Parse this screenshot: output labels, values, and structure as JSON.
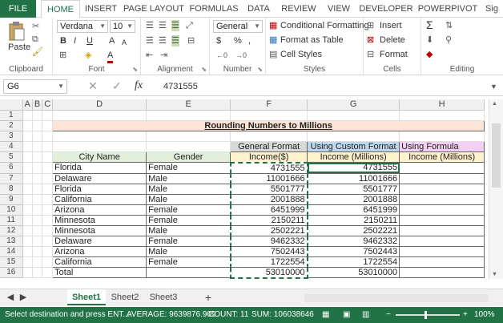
{
  "ribbon_tabs": [
    "FILE",
    "HOME",
    "INSERT",
    "PAGE LAYOUT",
    "FORMULAS",
    "DATA",
    "REVIEW",
    "VIEW",
    "DEVELOPER",
    "POWERPIVOT",
    "Sig"
  ],
  "clipboard": {
    "paste": "Paste",
    "label": "Clipboard"
  },
  "font": {
    "name": "Verdana",
    "size": "10",
    "bold": "B",
    "italic": "I",
    "underline": "U",
    "grow": "A",
    "shrink": "A",
    "font_color": "A",
    "label": "Font"
  },
  "alignment": {
    "label": "Alignment"
  },
  "number": {
    "format": "General",
    "currency": "$",
    "percent": "%",
    "comma": ",",
    "label": "Number"
  },
  "styles": {
    "conditional": "Conditional Formatting",
    "format_table": "Format as Table",
    "cell_styles": "Cell Styles",
    "label": "Styles"
  },
  "cells": {
    "insert": "Insert",
    "delete": "Delete",
    "format": "Format",
    "label": "Cells"
  },
  "editing": {
    "sum": "Σ",
    "label": "Editing"
  },
  "formula_bar": {
    "name_box": "G6",
    "fx": "fx",
    "value": "4731555"
  },
  "columns": [
    "A",
    "B",
    "C",
    "D",
    "E",
    "F",
    "G",
    "H"
  ],
  "rows": [
    {
      "n": "1",
      "D": "",
      "E": "",
      "F": "",
      "G": "",
      "H": ""
    },
    {
      "n": "2",
      "D": "",
      "E": "",
      "F": "",
      "G": "",
      "H": ""
    },
    {
      "n": "3",
      "D": "",
      "E": "",
      "F": "",
      "G": "",
      "H": ""
    },
    {
      "n": "4",
      "D": "",
      "E": "",
      "F": "",
      "G": "",
      "H": ""
    },
    {
      "n": "5",
      "D": "",
      "E": "",
      "F": "",
      "G": "",
      "H": ""
    },
    {
      "n": "6",
      "D": "Florida",
      "E": "Female",
      "F": "4731555",
      "G": "4731555",
      "H": ""
    },
    {
      "n": "7",
      "D": "Delaware",
      "E": "Male",
      "F": "11001666",
      "G": "11001666",
      "H": ""
    },
    {
      "n": "8",
      "D": "Florida",
      "E": "Male",
      "F": "5501777",
      "G": "5501777",
      "H": ""
    },
    {
      "n": "9",
      "D": "California",
      "E": "Male",
      "F": "2001888",
      "G": "2001888",
      "H": ""
    },
    {
      "n": "10",
      "D": "Arizona",
      "E": "Female",
      "F": "6451999",
      "G": "6451999",
      "H": ""
    },
    {
      "n": "11",
      "D": "Minnesota",
      "E": "Female",
      "F": "2150211",
      "G": "2150211",
      "H": ""
    },
    {
      "n": "12",
      "D": "Minnesota",
      "E": "Male",
      "F": "2502221",
      "G": "2502221",
      "H": ""
    },
    {
      "n": "13",
      "D": "Delaware",
      "E": "Female",
      "F": "9462332",
      "G": "9462332",
      "H": ""
    },
    {
      "n": "14",
      "D": "Arizona",
      "E": "Male",
      "F": "7502443",
      "G": "7502443",
      "H": ""
    },
    {
      "n": "15",
      "D": "California",
      "E": "Female",
      "F": "1722554",
      "G": "1722554",
      "H": ""
    },
    {
      "n": "16",
      "D": "Total",
      "E": "",
      "F": "53010000",
      "G": "53010000",
      "H": ""
    }
  ],
  "title": "Rounding Numbers to Millions",
  "headers4": {
    "F": "General Format",
    "G": "Using Custom Format",
    "H": "Using Formula"
  },
  "headers5": {
    "D": "City Name",
    "E": "Gender",
    "F": "Income($)",
    "G": "Income (Millions)",
    "H": "Income (Millions)"
  },
  "sheet_tabs": [
    "Sheet1",
    "Sheet2",
    "Sheet3"
  ],
  "add_sheet": "+",
  "status": {
    "message": "Select destination and press ENT...",
    "average": "AVERAGE: 9639876.909",
    "count": "COUNT: 11",
    "sum": "SUM: 106038646",
    "zoom": "100%"
  },
  "colors": {
    "excel_green": "#217346",
    "title_bg": "#fce4d6",
    "hdr_f": "#d9d9d9",
    "hdr_g": "#bdd7ee",
    "hdr_h": "#f4cff4",
    "hdr5": "#fff2cc",
    "hdr_de": "#e2efda"
  }
}
